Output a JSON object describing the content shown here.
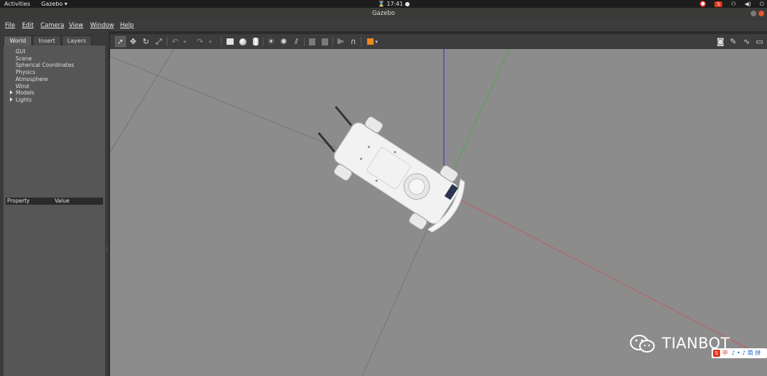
{
  "topbar": {
    "activities": "Activities",
    "app_menu": "Gazebo ▾",
    "clock": "⌛ 17:41 ●",
    "tray_icons": [
      "input-method-badge",
      "sogou-s-icon",
      "network-icon",
      "volume-icon",
      "power-icon"
    ],
    "tray_s": "S"
  },
  "window": {
    "title": "Gazebo"
  },
  "menu": {
    "items": [
      {
        "label": "File",
        "mnemonic": "F"
      },
      {
        "label": "Edit",
        "mnemonic": "E"
      },
      {
        "label": "Camera",
        "mnemonic": "C"
      },
      {
        "label": "View",
        "mnemonic": "V"
      },
      {
        "label": "Window",
        "mnemonic": "W"
      },
      {
        "label": "Help",
        "mnemonic": "H"
      }
    ]
  },
  "left_panel": {
    "tabs": [
      "World",
      "Insert",
      "Layers"
    ],
    "active_tab": "World",
    "tree": [
      {
        "label": "GUI",
        "expandable": false
      },
      {
        "label": "Scene",
        "expandable": false
      },
      {
        "label": "Spherical Coordinates",
        "expandable": false
      },
      {
        "label": "Physics",
        "expandable": false
      },
      {
        "label": "Atmosphere",
        "expandable": false
      },
      {
        "label": "Wind",
        "expandable": false
      },
      {
        "label": "Models",
        "expandable": true
      },
      {
        "label": "Lights",
        "expandable": true
      }
    ],
    "property_header": {
      "property": "Property",
      "value": "Value"
    }
  },
  "toolbar": {
    "left": [
      "select-arrow-icon",
      "translate-icon",
      "rotate-icon",
      "scale-icon",
      "undo-icon",
      "undo-dropdown-icon",
      "redo-icon",
      "redo-dropdown-icon",
      "box-icon",
      "sphere-icon",
      "cylinder-icon",
      "point-light-icon",
      "spot-light-icon",
      "directional-light-icon",
      "copy-icon",
      "paste-icon",
      "align-icon",
      "snap-icon",
      "view-angle-icon"
    ],
    "right": [
      "screenshot-icon",
      "log-icon",
      "plot-icon",
      "video-icon"
    ]
  },
  "watermark": {
    "text": "TIANBOT"
  },
  "ime": {
    "s": "S",
    "zh": "中",
    "rest": "♪ • ♪ 简 拼"
  },
  "colors": {
    "viewport_bg": "#8c8c8c",
    "axis_x": "#c55a5a",
    "axis_y": "#4aa84a",
    "axis_z": "#2a2ad8",
    "accent_orange": "#f08a1c"
  }
}
